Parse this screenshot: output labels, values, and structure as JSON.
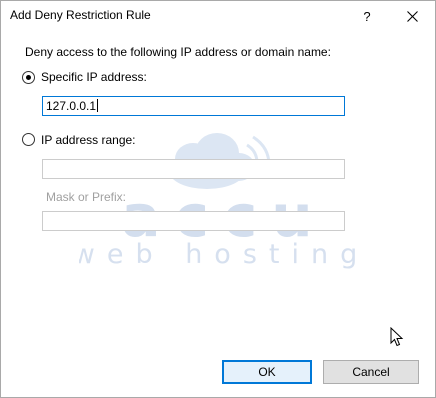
{
  "window": {
    "title": "Add Deny Restriction Rule",
    "help_label": "?"
  },
  "form": {
    "prompt": "Deny access to the following IP address or domain name:",
    "specific_ip": {
      "label": "Specific IP address:",
      "selected": true,
      "value": "127.0.0.1"
    },
    "ip_range": {
      "label": "IP address range:",
      "selected": false,
      "value": ""
    },
    "mask": {
      "label": "Mask or Prefix:",
      "value": ""
    }
  },
  "watermark": {
    "brand": "accu",
    "tagline": "web hosting"
  },
  "buttons": {
    "ok": "OK",
    "cancel": "Cancel"
  },
  "colors": {
    "focus_border": "#0078d7",
    "ok_background": "#e5f1fb",
    "cancel_background": "#e1e1e1",
    "disabled_text": "#a0a0a0",
    "watermark": "#c8d6ea"
  }
}
